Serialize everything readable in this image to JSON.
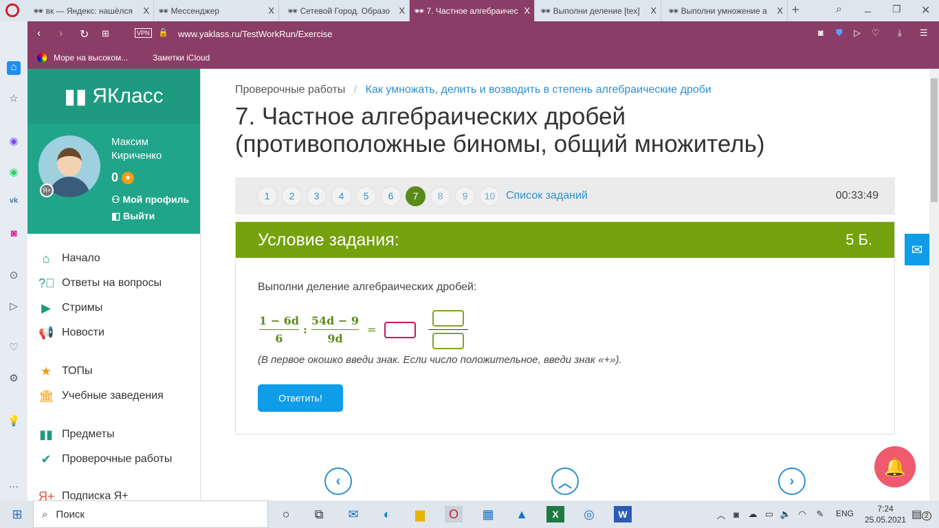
{
  "browser": {
    "tabs": [
      {
        "label": "вк — Яндекс: нашёлся"
      },
      {
        "label": "Мессенджер"
      },
      {
        "label": "Сетевой Город. Образо"
      },
      {
        "label": "7. Частное алгебраичес"
      },
      {
        "label": "Выполни деление [tex]"
      },
      {
        "label": "Выполни умножение а"
      }
    ],
    "close_glyph": "X",
    "url": "www.yaklass.ru/TestWorkRun/Exercise",
    "vpn": "VPN",
    "bookmarks": [
      {
        "label": "Море на высоком..."
      },
      {
        "label": "Заметки iCloud"
      }
    ]
  },
  "site": {
    "logo": "ЯКласс",
    "user": {
      "first": "Максим",
      "last": "Кириченко",
      "points": "0",
      "profile": "Мой профиль",
      "logout": "Выйти"
    },
    "menu": [
      {
        "label": "Начало"
      },
      {
        "label": "Ответы на вопросы"
      },
      {
        "label": "Стримы"
      },
      {
        "label": "Новости"
      },
      {
        "label": "ТОПы"
      },
      {
        "label": "Учебные заведения"
      },
      {
        "label": "Предметы"
      },
      {
        "label": "Проверочные работы"
      },
      {
        "label": "Подписка Я+"
      }
    ]
  },
  "main": {
    "breadcrumb": {
      "root": "Проверочные работы",
      "sep": "/",
      "current": "Как умножать, делить и возводить в степень алгебраические дроби"
    },
    "title_line1": "7. Частное алгебраических дробей",
    "title_line2": "(противоположные биномы, общий множитель)",
    "tasks": [
      "1",
      "2",
      "3",
      "4",
      "5",
      "6",
      "7",
      "8",
      "9",
      "10"
    ],
    "current_task": "7",
    "task_list": "Список заданий",
    "timer": "00:33:49",
    "condition_header": "Условие задания:",
    "points": "5 Б.",
    "prompt": "Выполни деление алгебраических дробей:",
    "f1_num": "1 − 6d",
    "f1_den": "6",
    "colon": ":",
    "f2_num": "54d − 9",
    "f2_den": "9d",
    "eq": "=",
    "hint": "(В первое окошко введи знак. Если число положительное, введи знак «+»).",
    "answer_button": "Ответить!"
  },
  "taskbar": {
    "search": "Поиск",
    "lang": "ENG",
    "time": "7:24",
    "date": "25.05.2021",
    "notifications": "2"
  }
}
